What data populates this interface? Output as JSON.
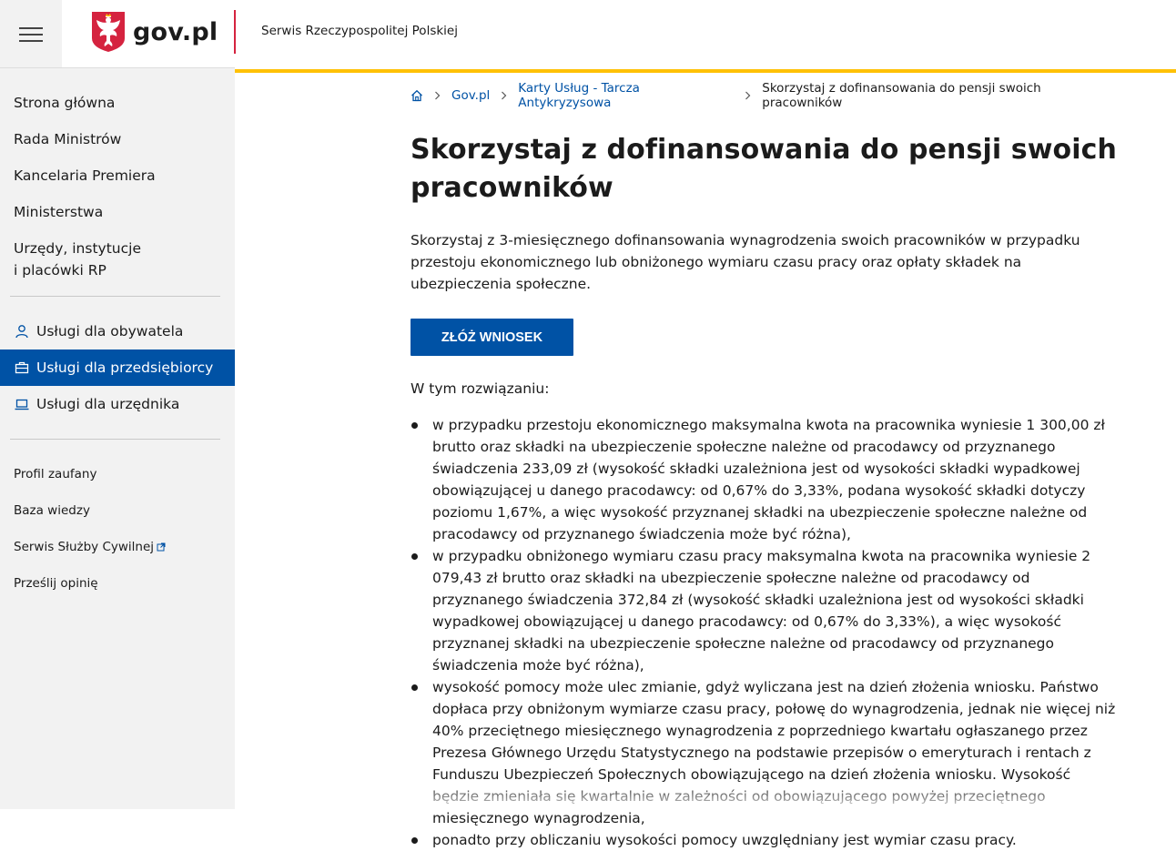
{
  "header": {
    "logo_text": "gov.pl",
    "service_name": "Serwis Rzeczypospolitej Polskiej"
  },
  "sidebar": {
    "main_items": [
      {
        "label": "Strona główna"
      },
      {
        "label": "Rada Ministrów"
      },
      {
        "label": "Kancelaria Premiera"
      },
      {
        "label": "Ministerstwa"
      },
      {
        "label": "Urzędy, instytucje i placówki RP"
      }
    ],
    "service_items": [
      {
        "label": "Usługi dla obywatela",
        "icon": "user-icon"
      },
      {
        "label": "Usługi dla przedsiębiorcy",
        "icon": "briefcase-icon",
        "active": true
      },
      {
        "label": "Usługi dla urzędnika",
        "icon": "laptop-icon"
      }
    ],
    "extra_items": [
      {
        "label": "Profil zaufany"
      },
      {
        "label": "Baza wiedzy"
      },
      {
        "label": "Serwis Służby Cywilnej",
        "external": true
      },
      {
        "label": "Prześlij opinię"
      }
    ]
  },
  "breadcrumb": {
    "home_icon": "home-icon",
    "items": [
      {
        "label": "Gov.pl"
      },
      {
        "label": "Karty Usług - Tarcza Antykryzysowa"
      },
      {
        "label": "Skorzystaj z dofinansowania do pensji swoich pracowników"
      }
    ]
  },
  "main": {
    "title": "Skorzystaj z dofinansowania do pensji swoich pracowników",
    "intro": "Skorzystaj z 3-miesięcznego dofinansowania wynagrodzenia swoich pracowników w przypadku przestoju ekonomicznego lub obniżonego wymiaru czasu pracy oraz opłaty składek na ubezpieczenia społeczne.",
    "cta_label": "ZŁÓŻ WNIOSEK",
    "solution_label": "W tym rozwiązaniu:",
    "bullets": [
      "w przypadku przestoju ekonomicznego maksymalna kwota na pracownika wyniesie 1 300,00 zł brutto oraz składki na ubezpieczenie społeczne należne od pracodawcy od przyznanego świadczenia 233,09 zł (wysokość składki uzależniona jest od wysokości składki wypadkowej obowiązującej u danego pracodawcy: od 0,67% do 3,33%, podana wysokość składki dotyczy poziomu 1,67%, a więc wysokość przyznanej składki na ubezpieczenie społeczne należne od pracodawcy od przyznanego świadczenia może być różna),",
      "w przypadku obniżonego wymiaru czasu pracy maksymalna kwota na pracownika wyniesie 2 079,43 zł brutto oraz składki na ubezpieczenie społeczne należne od pracodawcy od przyznanego świadczenia 372,84 zł (wysokość składki uzależniona jest od wysokości składki wypadkowej obowiązującej u danego pracodawcy: od 0,67% do 3,33%), a więc wysokość przyznanej składki na ubezpieczenie społeczne należne od pracodawcy od przyznanego świadczenia może być różna),",
      "wysokość pomocy może ulec zmianie, gdyż wyliczana jest na dzień złożenia wniosku. Państwo dopłaca przy obniżonym wymiarze czasu pracy, połowę do wynagrodzenia, jednak nie więcej niż 40% przeciętnego miesięcznego wynagrodzenia z poprzedniego kwartału ogłaszanego przez Prezesa Głównego Urzędu Statystycznego na podstawie przepisów o emeryturach i rentach z Funduszu Ubezpieczeń Społecznych obowiązującego na dzień złożenia wniosku. Wysokość będzie zmieniała się kwartalnie w zależności od obowiązującego powyżej przeciętnego miesięcznego wynagrodzenia,",
      "ponadto przy obliczaniu wysokości pomocy uwzględniany jest wymiar czasu pracy."
    ]
  },
  "colors": {
    "brand_blue": "#0052a5",
    "accent_yellow": "#ffc107",
    "accent_red": "#d5233f",
    "sidebar_bg": "#f2f2f2"
  }
}
